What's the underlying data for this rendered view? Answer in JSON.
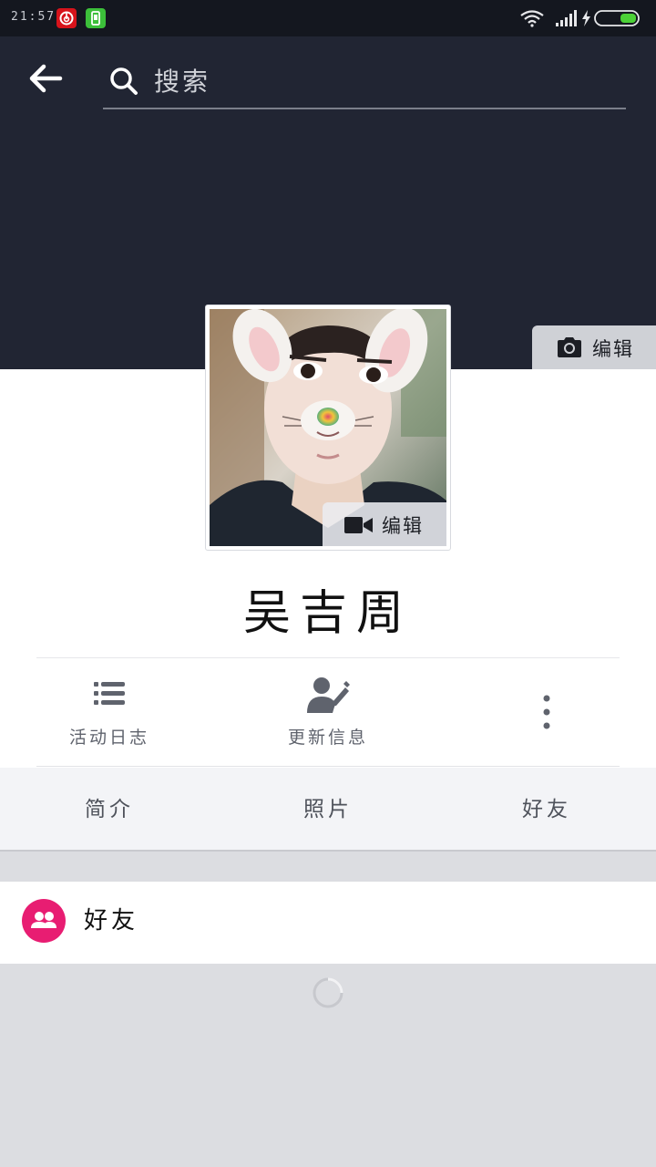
{
  "status_bar": {
    "time": "21:57",
    "app_icons": [
      "netease-music-icon",
      "phone-manager-icon"
    ],
    "indicators": [
      "wifi-icon",
      "signal-icon",
      "charging-icon",
      "battery-icon"
    ]
  },
  "header": {
    "back_icon": "back-arrow-icon",
    "search": {
      "placeholder": "搜索",
      "icon": "search-icon"
    },
    "cover_edit_label": "编辑"
  },
  "profile": {
    "avatar_edit_label": "编辑",
    "name": "吴吉周"
  },
  "actions": [
    {
      "label": "活动日志",
      "icon": "list-icon"
    },
    {
      "label": "更新信息",
      "icon": "edit-profile-icon"
    },
    {
      "label": "",
      "icon": "more-vertical-icon"
    }
  ],
  "tabs": [
    "简介",
    "照片",
    "好友"
  ],
  "friends_section": {
    "label": "好友",
    "icon": "friends-icon"
  },
  "colors": {
    "header_bg": "#212533",
    "accent": "#e81d72",
    "page_bg": "#dcdde1"
  }
}
